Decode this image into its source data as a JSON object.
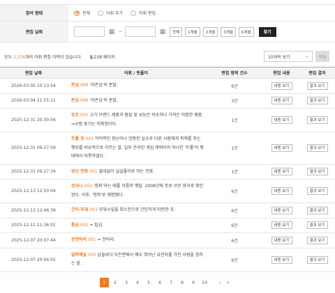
{
  "filter": {
    "type_label": "참여 형태",
    "options": [
      "전체",
      "어휘 추가",
      "어휘 편집"
    ],
    "selected_option": "전체",
    "date_label": "편집 날짜",
    "date_from": "",
    "date_to": "",
    "tilde": "~",
    "period_buttons": [
      "전체",
      "1개월",
      "2개월",
      "3개월",
      "6개월"
    ],
    "find_label": "찾기"
  },
  "summary": {
    "prefix": "모두 ",
    "count": "2,376",
    "suffix": "개의 어휘 편집 이력이 있습니다.",
    "current_page": "1",
    "page_total": "/238 페이지"
  },
  "page_size": {
    "selected": "10개씩 보기",
    "apply_label": "적용"
  },
  "colors": {
    "accent": "#f07a20",
    "dark_button": "#222222"
  },
  "table": {
    "headers": [
      "편집 날짜",
      "어휘 / 뜻풀이",
      "편집 항목 건수",
      "편집 내용",
      "편집 결과"
    ],
    "view_content_label": "내용 보기",
    "view_result_label": "결과 보기",
    "rows": [
      {
        "date": "2026-03-05 10:13:54",
        "word": "존심",
        "num": "006",
        "def": "'자존심'의 준말.",
        "count": "6건"
      },
      {
        "date": "2026-03-04 21:55:11",
        "word": "존심",
        "num": "006",
        "def": "'자존심'의 준말.",
        "count": "3건"
      },
      {
        "date": "2025-12-31 20:30:04",
        "word": "듀프",
        "num": "001",
        "def": "고가 브랜드 제품과 품질 및 성능은 비슷하나 가격은 저렴한 제품. ⇒규범 표기는 미확정이다.",
        "count": "1건"
      },
      {
        "date": "2025-12-31 06:27:59",
        "word": "트롤 짓",
        "num": "001",
        "def": "악의적인 장난이나 엉뚱한 실수로 다른 사람에게 피해를 주는 행위를 비유적으로 이르는 말. 일부 온라인 게임 캐릭터의 하나인 '트롤'의 행태에서 비롯하였다.",
        "count": "1건"
      },
      {
        "date": "2025-12-31 06:27:34",
        "word": "장난 전화",
        "num": "001",
        "def": "쓸데없이 실실풀이로 하는 전화.",
        "count": "1건"
      },
      {
        "date": "2025-12-13 12:50:04",
        "word": "컷사나",
        "num": "002",
        "def": "'청피'라는 태틀 이름의 옛말. 2009년에 주로 쓰인 용어로 확인된다. 이후, '청피'로 체명됐다.",
        "count": "6건"
      },
      {
        "date": "2025-12-13 12:46:39",
        "word": "간이-부엌",
        "num": "001",
        "def": "부엌시설을 최소한으로 간단하게 마련한 곳.",
        "count": "6건"
      },
      {
        "date": "2025-12-12 21:36:01",
        "word": "톱금",
        "num": "001",
        "def": "= 탑금.",
        "count": "6건"
      },
      {
        "date": "2025-12-07 20:07:44",
        "word": "잔전바리",
        "num": "001",
        "def": "= 잔바리.",
        "count": "6건"
      },
      {
        "date": "2025-12-07 20:04:55",
        "word": "알파메일",
        "num": "002",
        "def": "남들보다 모든면에서 매우 뛰어난 유전자를 가진 사람을 칭하는 말.",
        "count": "6건"
      }
    ]
  },
  "pagination": {
    "pages": [
      "1",
      "2",
      "3",
      "4",
      "5",
      "6",
      "7",
      "8",
      "9",
      "10"
    ],
    "next": "›",
    "last": "»"
  }
}
